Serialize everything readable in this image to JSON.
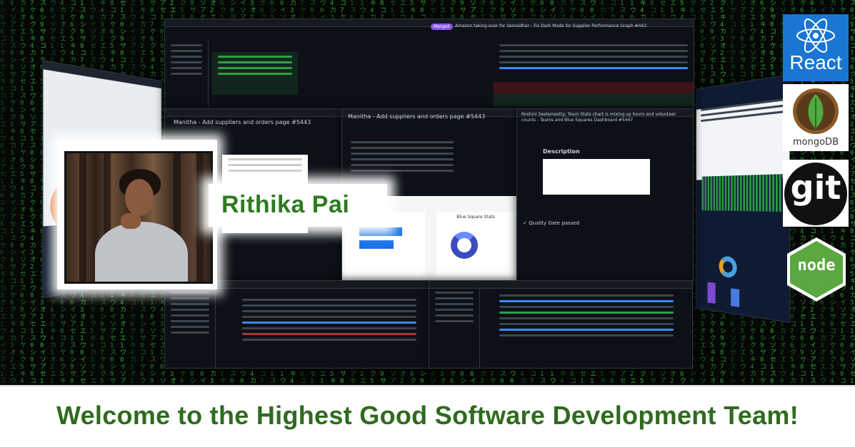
{
  "profile": {
    "name": "Rithika Pai"
  },
  "banner": {
    "headline": "Welcome to the Highest Good Software Development Team!"
  },
  "badges": {
    "react": {
      "label": "React",
      "icon": "react-atom-icon",
      "color": "#1976d2"
    },
    "mongodb": {
      "label": "mongoDB",
      "icon": "mongodb-leaf-icon",
      "color": "#4faa41"
    },
    "git": {
      "label": "git",
      "icon": "git-logo-icon",
      "color": "#111111"
    },
    "node": {
      "label": "node",
      "icon": "nodejs-hexagon-icon",
      "color": "#5aa83f"
    }
  },
  "windows": {
    "pr_top": {
      "title": "Amazon taking over for Vamsidhar - Fix Dark Mode for Supplier Performance Graph #443",
      "status": "Merged"
    },
    "pr_left": {
      "title": "Manitha - Add suppliers and orders page #5443"
    },
    "pr_mid": {
      "title": "Manitha - Add suppliers and orders page #5443"
    },
    "pr_right": {
      "title": "Roshini Seelamsetty: Team Stats chart is mixing up hours and volunteer counts - Teams and Blue Squares Dashboard #5447",
      "section": "Description",
      "quality": "Quality Gate passed"
    },
    "chart_panel": {
      "right_title": "Blue Square Stats"
    }
  },
  "colors": {
    "accent_green": "#2f6b1f",
    "matrix_green": "#3fbf4a"
  }
}
